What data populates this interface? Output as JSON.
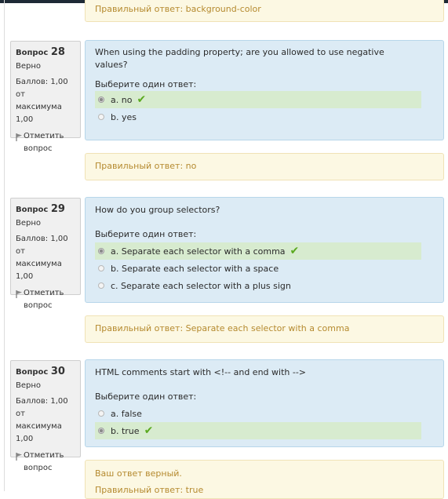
{
  "top_feedback": {
    "right_answer": "Правильный ответ: background-color"
  },
  "questions": [
    {
      "label": "Вопрос",
      "number": "28",
      "state": "Верно",
      "grade_line1": "Баллов: 1,00 от",
      "grade_line2": "максимума 1,00",
      "flag_line1": "Отметить",
      "flag_line2": "вопрос",
      "text": "When using the padding property; are you allowed to use negative values?",
      "prompt": "Выберите один ответ:",
      "options": [
        {
          "label": "a. no",
          "selected": true,
          "correct": true
        },
        {
          "label": "b. yes",
          "selected": false,
          "correct": false
        }
      ],
      "right_answer": "Правильный ответ: no"
    },
    {
      "label": "Вопрос",
      "number": "29",
      "state": "Верно",
      "grade_line1": "Баллов: 1,00 от",
      "grade_line2": "максимума 1,00",
      "flag_line1": "Отметить",
      "flag_line2": "вопрос",
      "text": "How do you group selectors?",
      "prompt": "Выберите один ответ:",
      "options": [
        {
          "label": "a. Separate each selector with a comma",
          "selected": true,
          "correct": true
        },
        {
          "label": "b. Separate each selector with a space",
          "selected": false,
          "correct": false
        },
        {
          "label": "c. Separate each selector with a plus sign",
          "selected": false,
          "correct": false
        }
      ],
      "right_answer": "Правильный ответ: Separate each selector with a comma"
    },
    {
      "label": "Вопрос",
      "number": "30",
      "state": "Верно",
      "grade_line1": "Баллов: 1,00 от",
      "grade_line2": "максимума 1,00",
      "flag_line1": "Отметить",
      "flag_line2": "вопрос",
      "text": "HTML comments start with <!-- and end with -->",
      "prompt": "Выберите один ответ:",
      "options": [
        {
          "label": "a. false",
          "selected": false,
          "correct": false
        },
        {
          "label": "b. true",
          "selected": true,
          "correct": true
        }
      ],
      "your_answer": "Ваш ответ верный.",
      "right_answer": "Правильный ответ: true"
    }
  ],
  "colors": {
    "question_bg": "#dcebf5",
    "correct_option_bg": "#d7ebcf",
    "feedback_bg": "#fcf8e3",
    "feedback_text": "#b58a2f",
    "check": "#5aa91f"
  }
}
